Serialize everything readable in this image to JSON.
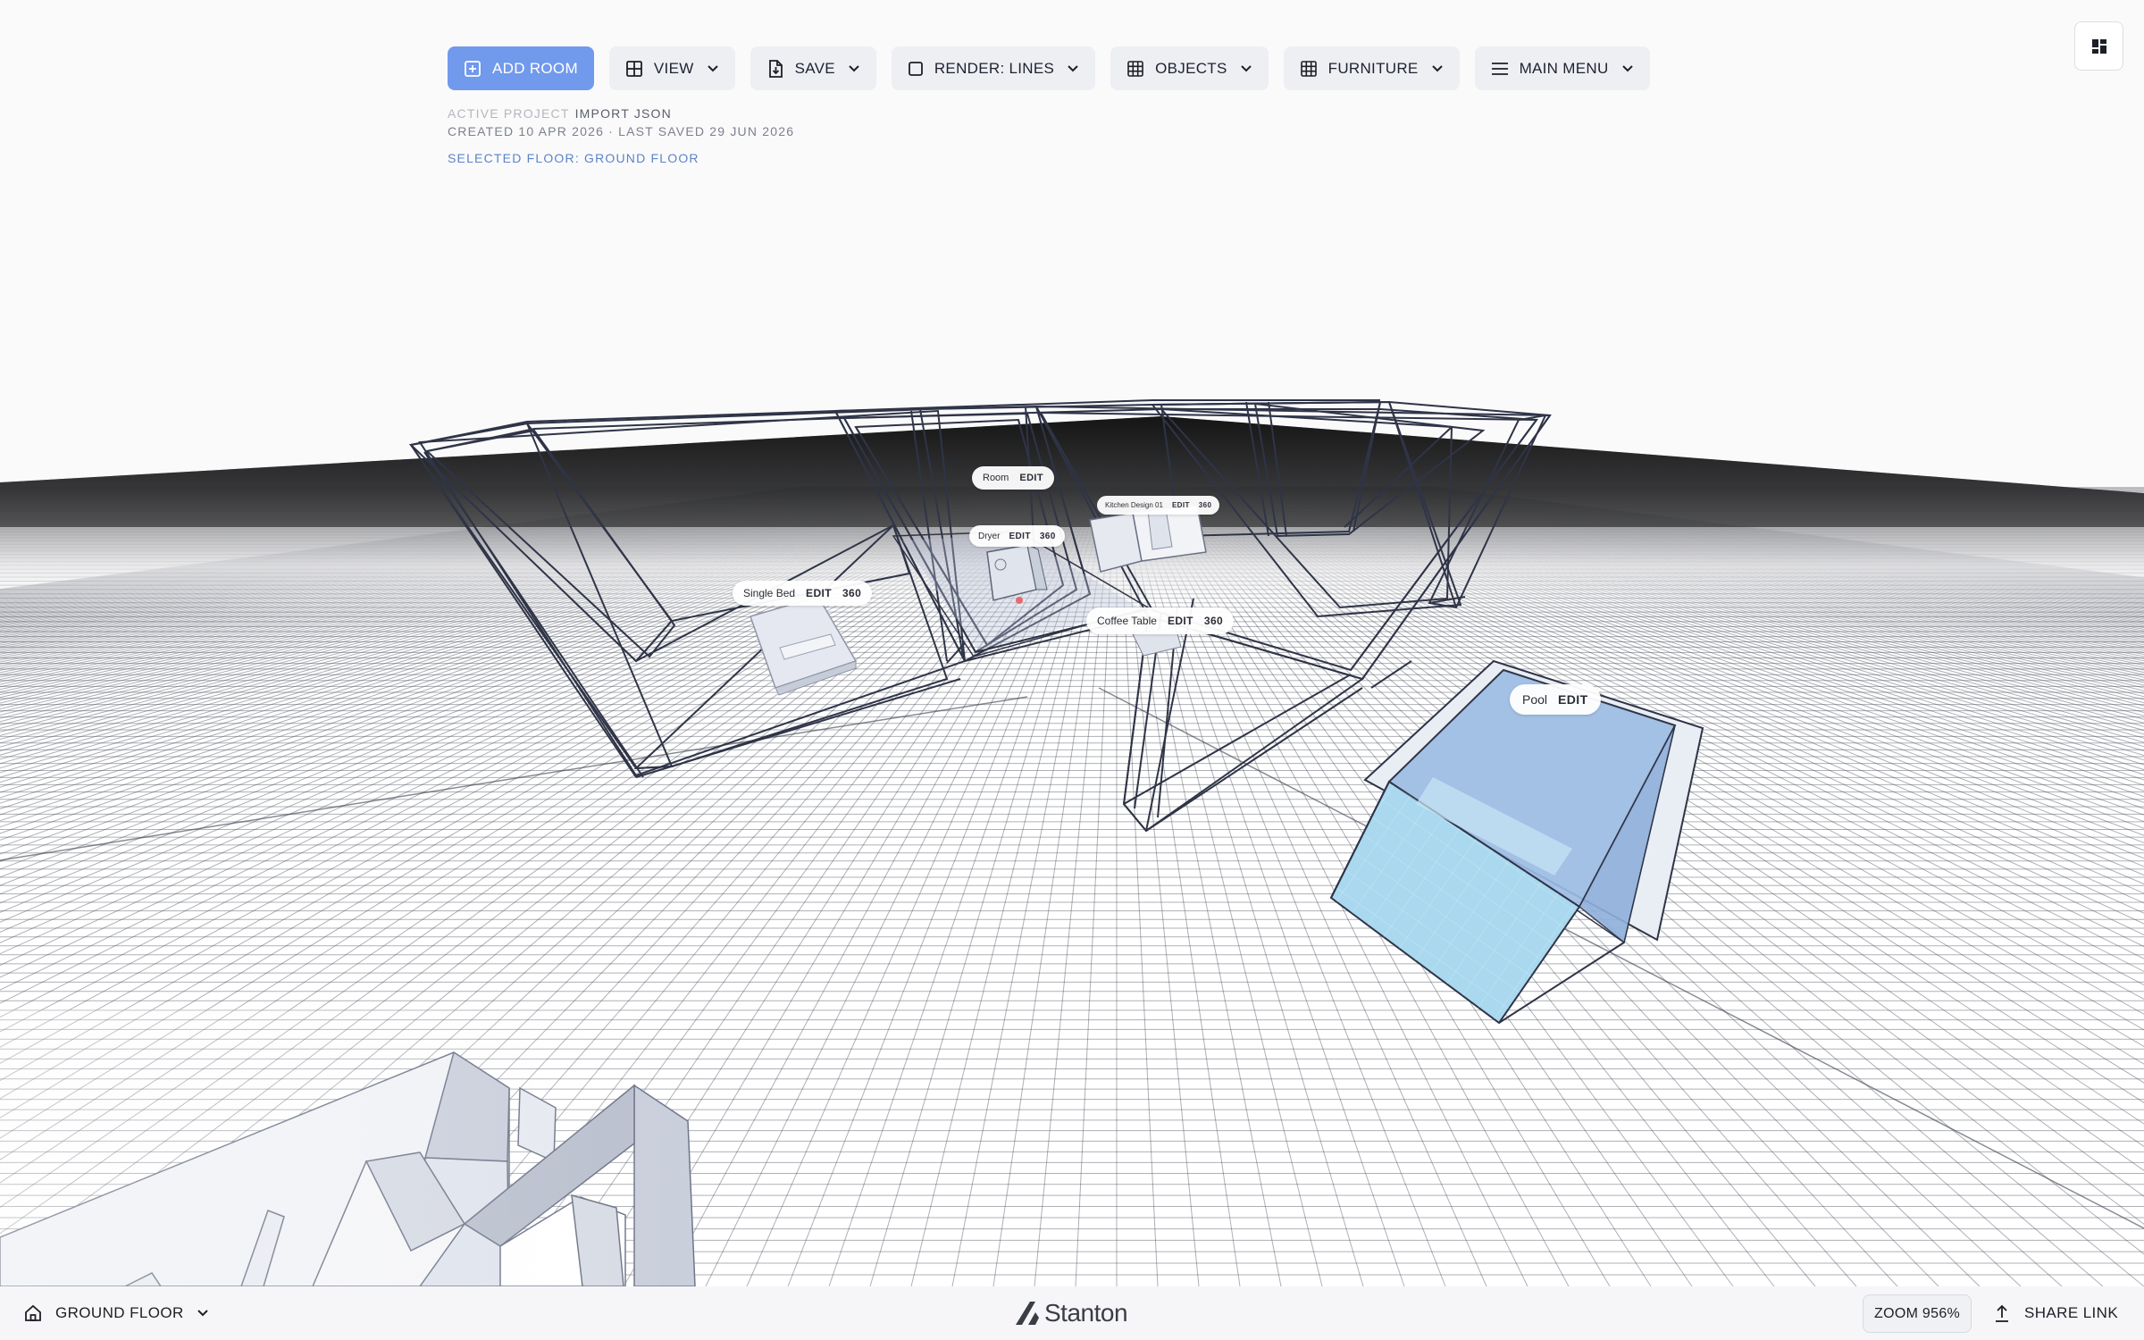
{
  "toolbar": {
    "add_room": "ADD ROOM",
    "view": "VIEW",
    "save": "SAVE",
    "render": "RENDER: LINES",
    "objects": "OBJECTS",
    "furniture": "FURNITURE",
    "main_menu": "MAIN MENU"
  },
  "project": {
    "label": "ACTIVE PROJECT",
    "name": "IMPORT JSON",
    "info": "CREATED 10 APR 2026 · LAST SAVED 29 JUN 2026",
    "selected_floor": "SELECTED FLOOR: GROUND FLOOR"
  },
  "objects": {
    "room": {
      "name": "Room",
      "edit": "EDIT"
    },
    "dryer": {
      "name": "Dryer",
      "edit": "EDIT",
      "view360": "360"
    },
    "kitchen": {
      "name": "Kitchen Design 01",
      "edit": "EDIT",
      "view360": "360"
    },
    "bed": {
      "name": "Single Bed",
      "edit": "EDIT",
      "view360": "360"
    },
    "coffee_table": {
      "name": "Coffee Table",
      "edit": "EDIT",
      "view360": "360"
    },
    "pool": {
      "name": "Pool",
      "edit": "EDIT"
    }
  },
  "bottom": {
    "floor": "GROUND FLOOR",
    "brand": "Stanton",
    "zoom": "ZOOM 956%",
    "share": "SHARE LINK"
  },
  "colors": {
    "accent": "#7199ec",
    "wireframe": "#2f3447",
    "pool": "#9cbce4",
    "pool_water": "#a9d8ef"
  },
  "icons": {
    "add_room": "plus-square-icon",
    "view": "grid-icon",
    "save": "file-download-icon",
    "render": "square-icon",
    "objects": "grid-icon",
    "furniture": "grid-icon",
    "main_menu": "menu-icon",
    "corner": "dashboard-icon",
    "floor": "home-icon",
    "share": "upload-icon"
  }
}
